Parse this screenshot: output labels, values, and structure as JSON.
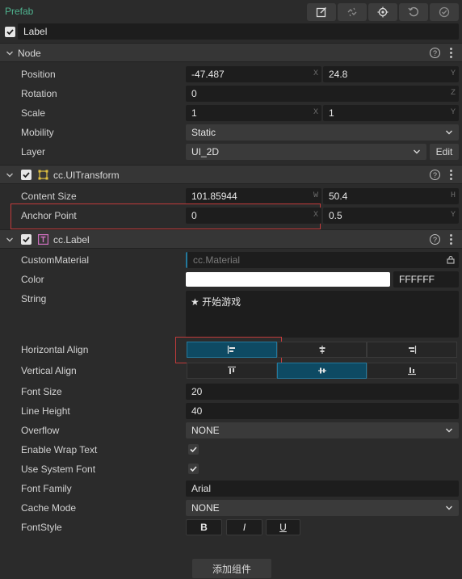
{
  "prefab": {
    "title": "Prefab"
  },
  "node_name": {
    "checked": true,
    "value": "Label"
  },
  "toolbar_icons": [
    "edit-icon",
    "unlink-icon",
    "locate-icon",
    "revert-icon",
    "apply-icon"
  ],
  "node_section": {
    "title": "Node",
    "position": {
      "label": "Position",
      "x": "-47.487",
      "y": "24.8",
      "x_axis": "X",
      "y_axis": "Y"
    },
    "rotation": {
      "label": "Rotation",
      "value": "0",
      "axis": "Z"
    },
    "scale": {
      "label": "Scale",
      "x": "1",
      "y": "1",
      "x_axis": "X",
      "y_axis": "Y"
    },
    "mobility": {
      "label": "Mobility",
      "value": "Static"
    },
    "layer": {
      "label": "Layer",
      "value": "UI_2D",
      "edit_label": "Edit"
    }
  },
  "ui_transform": {
    "title": "cc.UITransform",
    "content_size": {
      "label": "Content Size",
      "w": "101.85944",
      "h": "50.4",
      "w_axis": "W",
      "h_axis": "H"
    },
    "anchor_point": {
      "label": "Anchor Point",
      "x": "0",
      "y": "0.5",
      "x_axis": "X",
      "y_axis": "Y"
    }
  },
  "label_comp": {
    "title": "cc.Label",
    "custom_material": {
      "label": "CustomMaterial",
      "placeholder": "cc.Material"
    },
    "color": {
      "label": "Color",
      "hex": "FFFFFF",
      "swatch": "#ffffff"
    },
    "string": {
      "label": "String",
      "value": "★ 开始游戏"
    },
    "horizontal_align": {
      "label": "Horizontal Align",
      "selected": "left"
    },
    "vertical_align": {
      "label": "Vertical Align",
      "selected": "center"
    },
    "font_size": {
      "label": "Font Size",
      "value": "20"
    },
    "line_height": {
      "label": "Line Height",
      "value": "40"
    },
    "overflow": {
      "label": "Overflow",
      "value": "NONE"
    },
    "enable_wrap_text": {
      "label": "Enable Wrap Text",
      "checked": true
    },
    "use_system_font": {
      "label": "Use System Font",
      "checked": true
    },
    "font_family": {
      "label": "Font Family",
      "value": "Arial"
    },
    "cache_mode": {
      "label": "Cache Mode",
      "value": "NONE"
    },
    "font_style": {
      "label": "FontStyle",
      "bold": "B",
      "italic": "I",
      "underline": "U"
    }
  },
  "add_component": {
    "label": "添加组件"
  },
  "colors": {
    "accent": "#4fb38f",
    "selected": "#0e4a63",
    "highlight": "#c23b3b",
    "panel": "#2b2b2b"
  }
}
